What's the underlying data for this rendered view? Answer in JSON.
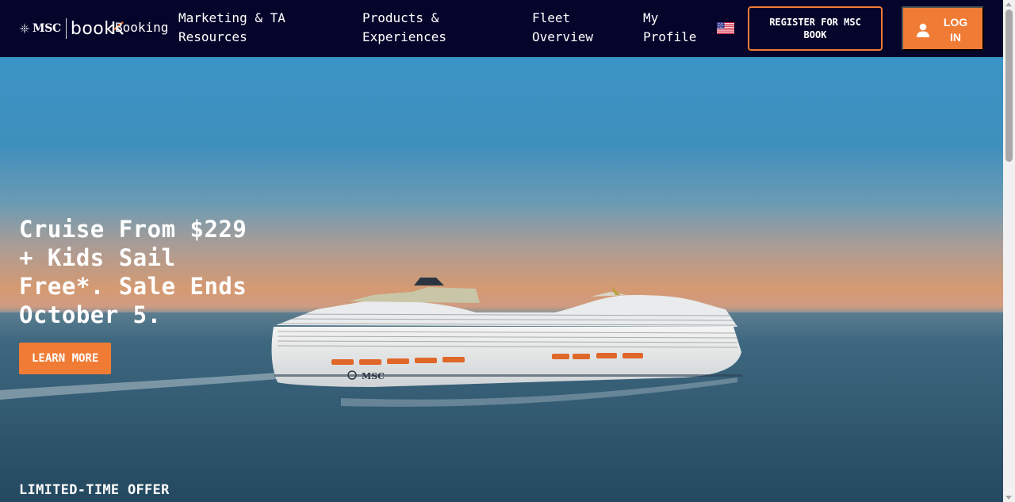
{
  "header": {
    "brand": {
      "msc": "MSC",
      "book": "book"
    },
    "nav": {
      "booking": "Booking",
      "marketing": "Marketing & TA Resources",
      "products": "Products & Experiences",
      "fleet": "Fleet Overview",
      "profile": "My Profile"
    },
    "flag_icon": "us-flag-icon",
    "register_label": "REGISTER FOR MSC BOOK",
    "login_label": "LOG IN",
    "login_icon": "user-icon"
  },
  "hero": {
    "title": "Cruise From $229 + Kids Sail Free*. Sale Ends October 5.",
    "cta_label": "LEARN MORE",
    "offer_label": "LIMITED-TIME OFFER",
    "ship_label": "MSC"
  },
  "colors": {
    "header_bg": "#05042b",
    "accent": "#f07b35",
    "text": "#ffffff"
  }
}
